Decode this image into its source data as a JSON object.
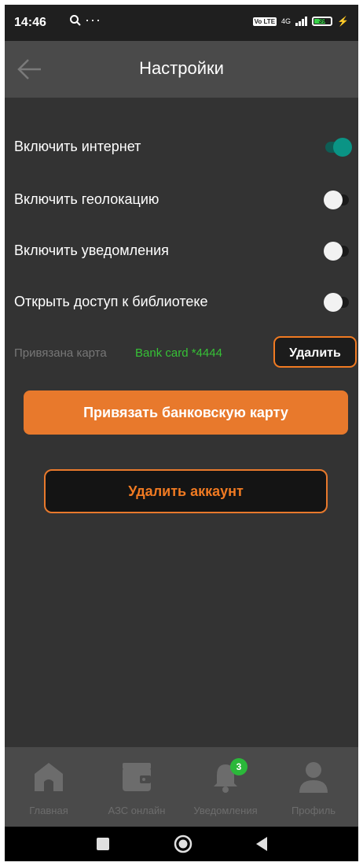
{
  "status_bar": {
    "time": "14:46",
    "dots": "···",
    "volte": "Vo LTE",
    "network": "4G",
    "battery": "39"
  },
  "app_bar": {
    "title": "Настройки"
  },
  "settings": [
    {
      "label": "Включить интернет",
      "on": true
    },
    {
      "label": "Включить геолокацию",
      "on": false
    },
    {
      "label": "Включить уведомления",
      "on": false
    },
    {
      "label": "Открыть доступ к библиотеке",
      "on": false
    }
  ],
  "card": {
    "label": "Привязана карта",
    "number": "Bank card *4444",
    "delete_label": "Удалить"
  },
  "bind_card_label": "Привязать банковскую карту",
  "delete_account_label": "Удалить аккаунт",
  "bottom_nav": [
    {
      "label": "Главная",
      "icon": "home-icon"
    },
    {
      "label": "АЗС онлайн",
      "icon": "wallet-icon"
    },
    {
      "label": "Уведомления",
      "icon": "bell-icon",
      "badge": "3"
    },
    {
      "label": "Профиль",
      "icon": "profile-icon"
    }
  ],
  "colors": {
    "accent": "#e8792c",
    "switch_on": "#0a9485",
    "card_number": "#36c136",
    "badge": "#2bb83a"
  }
}
